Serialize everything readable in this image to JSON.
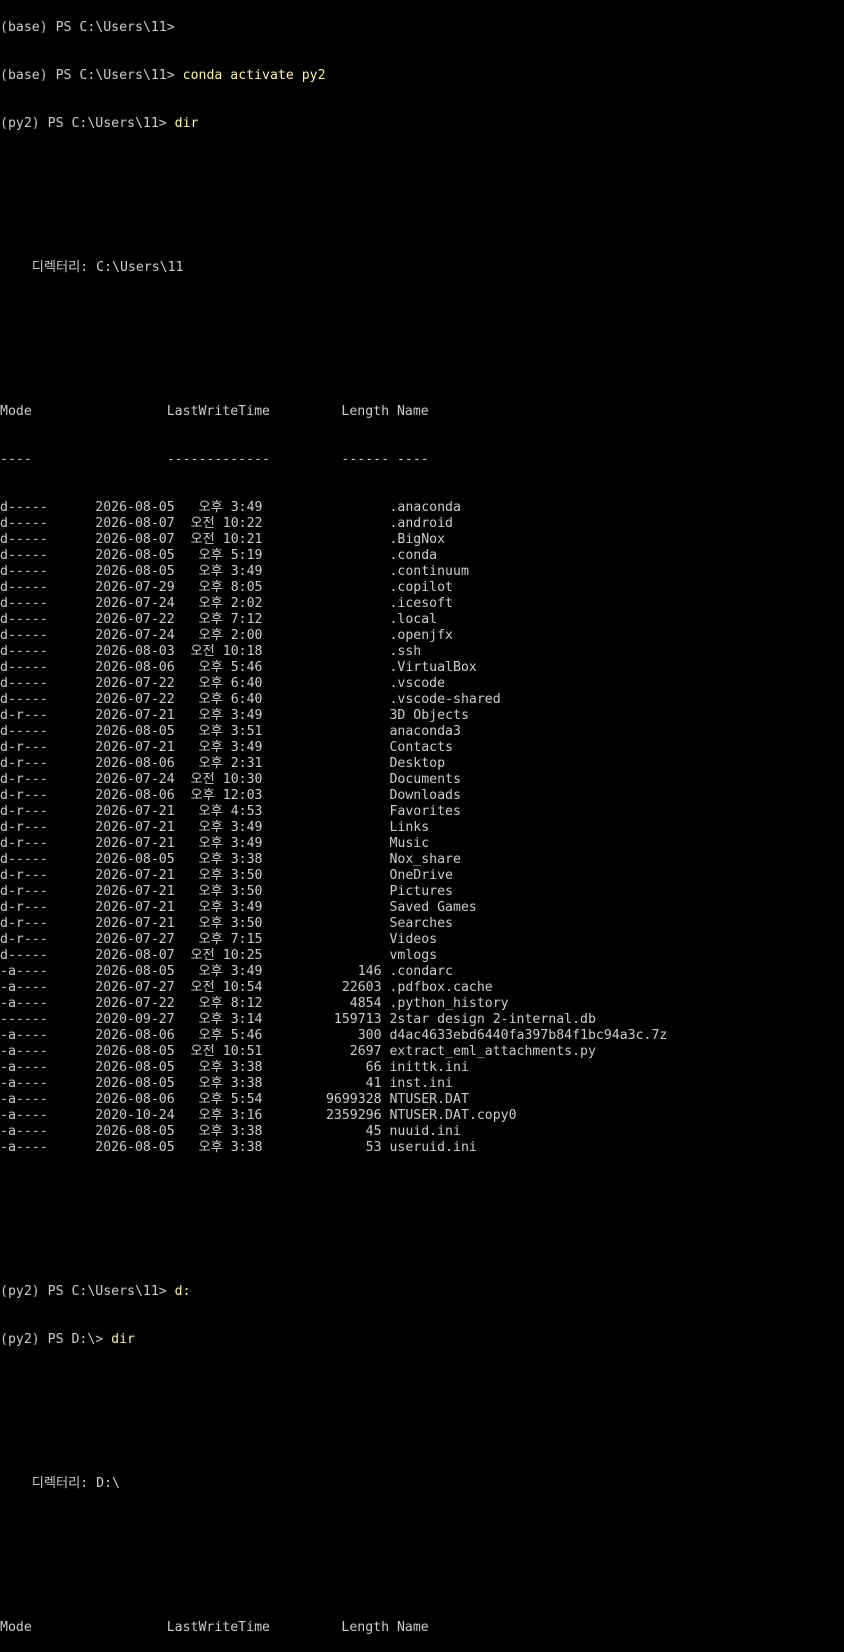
{
  "terminal": {
    "prev_prompt": "(base) PS C:\\Users\\11> ",
    "prev_command": "",
    "prompt1": "(base) PS C:\\Users\\11> ",
    "cmd1": "conda activate py2",
    "prompt2": "(py2) PS C:\\Users\\11> ",
    "cmd2": "dir",
    "dir1_label": "    디렉터리: C:\\Users\\11",
    "header": "Mode                 LastWriteTime         Length Name",
    "underline": "----                 -------------         ------ ----",
    "entries": [
      "d-----      2026-08-05   오후 3:49                .anaconda",
      "d-----      2026-08-07  오전 10:22                .android",
      "d-----      2026-08-07  오전 10:21                .BigNox",
      "d-----      2026-08-05   오후 5:19                .conda",
      "d-----      2026-08-05   오후 3:49                .continuum",
      "d-----      2026-07-29   오후 8:05                .copilot",
      "d-----      2026-07-24   오후 2:02                .icesoft",
      "d-----      2026-07-22   오후 7:12                .local",
      "d-----      2026-07-24   오후 2:00                .openjfx",
      "d-----      2026-08-03  오전 10:18                .ssh",
      "d-----      2026-08-06   오후 5:46                .VirtualBox",
      "d-----      2026-07-22   오후 6:40                .vscode",
      "d-----      2026-07-22   오후 6:40                .vscode-shared",
      "d-r---      2026-07-21   오후 3:49                3D Objects",
      "d-----      2026-08-05   오후 3:51                anaconda3",
      "d-r---      2026-07-21   오후 3:49                Contacts",
      "d-r---      2026-08-06   오후 2:31                Desktop",
      "d-r---      2026-07-24  오전 10:30                Documents",
      "d-r---      2026-08-06  오후 12:03                Downloads",
      "d-r---      2026-07-21   오후 4:53                Favorites",
      "d-r---      2026-07-21   오후 3:49                Links",
      "d-r---      2026-07-21   오후 3:49                Music",
      "d-----      2026-08-05   오후 3:38                Nox_share",
      "d-r---      2026-07-21   오후 3:50                OneDrive",
      "d-r---      2026-07-21   오후 3:50                Pictures",
      "d-r---      2026-07-21   오후 3:49                Saved Games",
      "d-r---      2026-07-21   오후 3:50                Searches",
      "d-r---      2026-07-27   오후 7:15                Videos",
      "d-----      2026-08-07  오전 10:25                vmlogs",
      "-a----      2026-08-05   오후 3:49            146 .condarc",
      "-a----      2026-07-27  오전 10:54          22603 .pdfbox.cache",
      "-a----      2026-07-22   오후 8:12           4854 .python_history",
      "------      2020-09-27   오후 3:14         159713 2star design 2-internal.db",
      "-a----      2026-08-06   오후 5:46            300 d4ac4633ebd6440fa397b84f1bc94a3c.7z",
      "-a----      2026-08-05  오전 10:51           2697 extract_eml_attachments.py",
      "-a----      2026-08-05   오후 3:38             66 inittk.ini",
      "-a----      2026-08-05   오후 3:38             41 inst.ini",
      "-a----      2026-08-06   오후 5:54        9699328 NTUSER.DAT",
      "-a----      2020-10-24   오후 3:16        2359296 NTUSER.DAT.copy0",
      "-a----      2026-08-05   오후 3:38             45 nuuid.ini",
      "-a----      2026-08-05   오후 3:38             53 useruid.ini"
    ],
    "prompt3": "(py2) PS C:\\Users\\11> ",
    "cmd3": "d:",
    "prompt4": "(py2) PS D:\\> ",
    "cmd4": "dir",
    "dir2_label": "    디렉터리: D:\\",
    "header2": "Mode                 LastWriteTime         Length Name"
  },
  "colors": {
    "background": "#000000",
    "text": "#cccccc",
    "command": "#f9f1a5"
  }
}
